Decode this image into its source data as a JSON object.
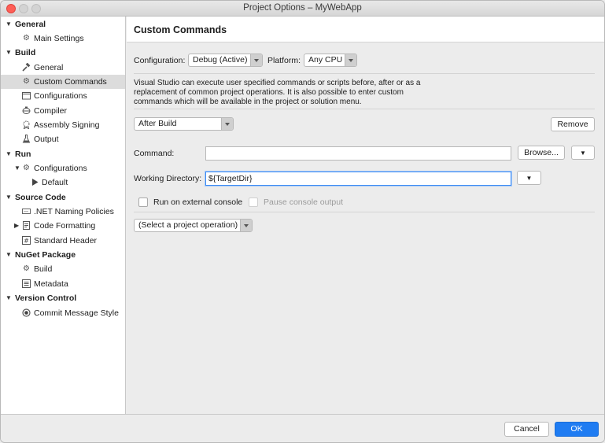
{
  "window": {
    "title": "Project Options – MyWebApp"
  },
  "sidebar": {
    "items": [
      {
        "kind": "category",
        "label": "General",
        "icon": "expanded-arrow"
      },
      {
        "kind": "item",
        "label": "Main Settings",
        "icon": "gear-icon"
      },
      {
        "kind": "category",
        "label": "Build",
        "icon": "expanded-arrow"
      },
      {
        "kind": "item",
        "label": "General",
        "icon": "hammer-icon"
      },
      {
        "kind": "item",
        "label": "Custom Commands",
        "icon": "gear-icon",
        "selected": true
      },
      {
        "kind": "item",
        "label": "Configurations",
        "icon": "window-icon"
      },
      {
        "kind": "item",
        "label": "Compiler",
        "icon": "compiler-icon"
      },
      {
        "kind": "item",
        "label": "Assembly Signing",
        "icon": "seal-icon"
      },
      {
        "kind": "item",
        "label": "Output",
        "icon": "flask-icon"
      },
      {
        "kind": "category",
        "label": "Run",
        "icon": "expanded-arrow"
      },
      {
        "kind": "item",
        "label": "Configurations",
        "icon": "gear-icon"
      },
      {
        "kind": "item",
        "label": "Default",
        "icon": "play-icon"
      },
      {
        "kind": "category",
        "label": "Source Code",
        "icon": "expanded-arrow"
      },
      {
        "kind": "item",
        "label": ".NET Naming Policies",
        "icon": "naming-icon"
      },
      {
        "kind": "item",
        "label": "Code Formatting",
        "icon": "document-icon"
      },
      {
        "kind": "item",
        "label": "Standard Header",
        "icon": "hash-icon"
      },
      {
        "kind": "category",
        "label": "NuGet Package",
        "icon": "expanded-arrow"
      },
      {
        "kind": "item",
        "label": "Build",
        "icon": "gear-icon"
      },
      {
        "kind": "item",
        "label": "Metadata",
        "icon": "list-icon"
      },
      {
        "kind": "category",
        "label": "Version Control",
        "icon": "expanded-arrow"
      },
      {
        "kind": "item",
        "label": "Commit Message Style",
        "icon": "radio-icon"
      }
    ]
  },
  "main": {
    "title": "Custom Commands",
    "configuration_label": "Configuration:",
    "configuration_value": "Debug (Active)",
    "platform_label": "Platform:",
    "platform_value": "Any CPU",
    "description": "Visual Studio can execute user specified commands or scripts before, after or as a replacement of common project operations. It is also possible to enter custom commands which will be available in the project or solution menu.",
    "step_value": "After Build",
    "remove_label": "Remove",
    "command_label": "Command:",
    "command_value": "",
    "browse_label": "Browse...",
    "working_dir_label": "Working Directory:",
    "working_dir_value": "${TargetDir}",
    "run_external_label": "Run on external console",
    "pause_output_label": "Pause console output",
    "operation_select": "(Select a project operation)"
  },
  "footer": {
    "cancel_label": "Cancel",
    "ok_label": "OK"
  },
  "colors": {
    "accent": "#1f7cf2",
    "close_button": "#fe5f57",
    "selection": "#dcdcdc"
  }
}
